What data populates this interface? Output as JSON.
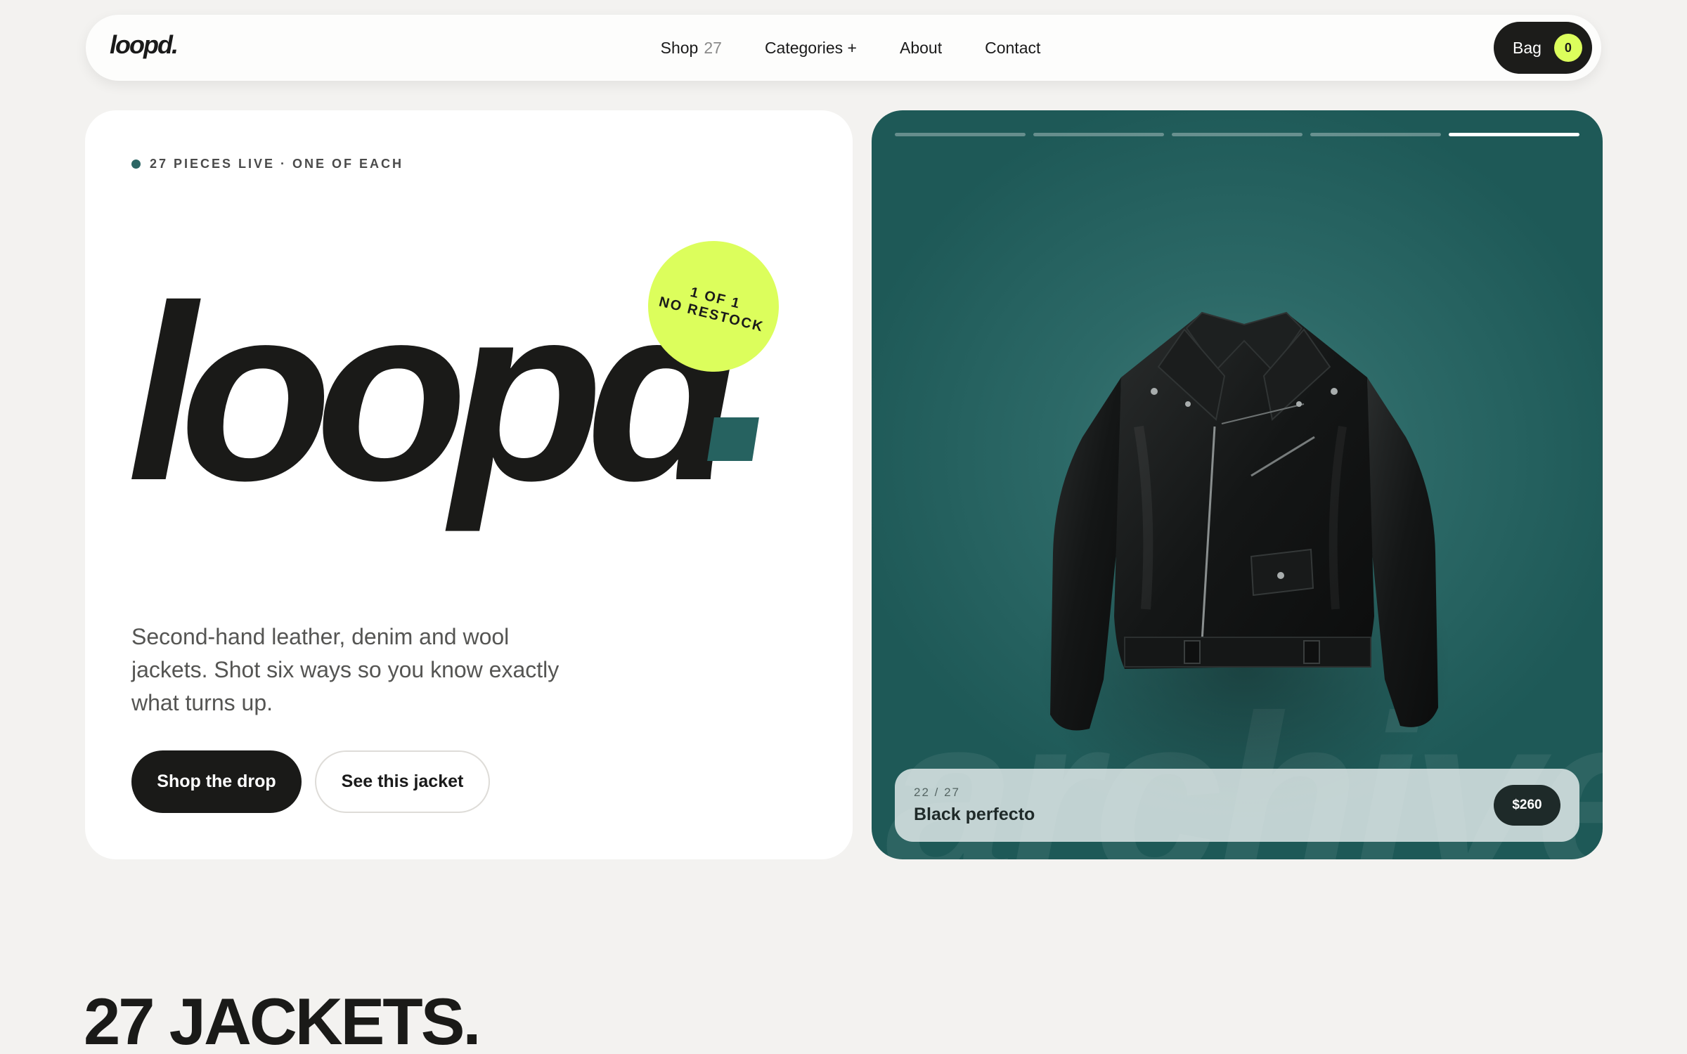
{
  "brand": {
    "logo": "loopd."
  },
  "nav": {
    "links": [
      {
        "label": "Shop",
        "count": "27"
      },
      {
        "label": "Categories +"
      },
      {
        "label": "About"
      },
      {
        "label": "Contact"
      }
    ],
    "bag": {
      "label": "Bag",
      "count": "0"
    }
  },
  "hero": {
    "eyebrow": "27 PIECES LIVE · ONE OF EACH",
    "wordmark": "loopd",
    "sticker": {
      "line1": "1 OF 1",
      "line2": "NO RESTOCK"
    },
    "description": "Second-hand leather, denim and wool jackets. Shot six ways so you know exactly what turns up.",
    "primary_cta": "Shop the drop",
    "secondary_cta": "See this jacket"
  },
  "carousel": {
    "segments": 5,
    "active_segment": 5,
    "watermark": "archive",
    "item": {
      "index": "22 / 27",
      "title": "Black perfecto",
      "price": "$260"
    }
  },
  "section": {
    "title": "27 JACKETS."
  },
  "colors": {
    "accent_lime": "#dcfe5c",
    "accent_teal": "#2c6664",
    "ink": "#1a1a18",
    "page_bg": "#f3f2f0"
  }
}
